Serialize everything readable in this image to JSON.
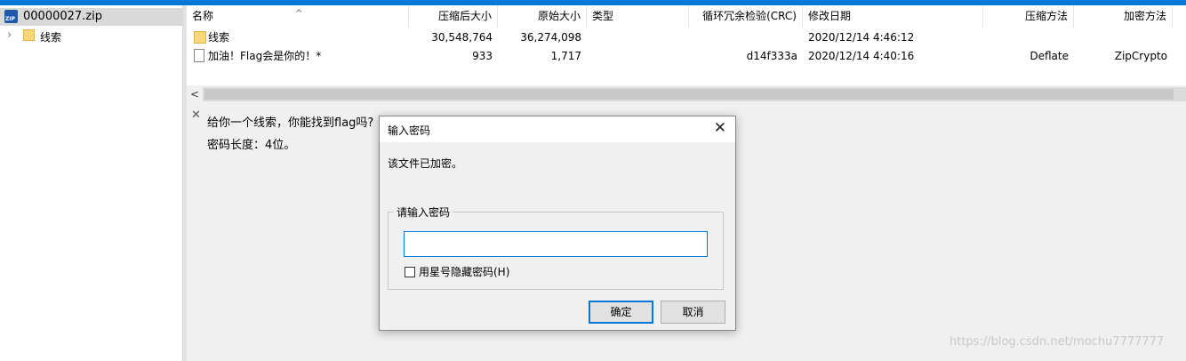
{
  "tree": {
    "root_label": "00000027.zip",
    "root_icon": "zip-icon",
    "children": [
      {
        "label": "线索",
        "icon": "folder-icon"
      }
    ]
  },
  "list": {
    "columns": [
      "名称",
      "压缩后大小",
      "原始大小",
      "类型",
      "循环冗余检验(CRC)",
      "修改日期",
      "压缩方法",
      "加密方法"
    ],
    "rows": [
      {
        "name": "线索",
        "icon": "folder-icon",
        "packed": "30,548,764",
        "size": "36,274,098",
        "type": "",
        "crc": "",
        "modified": "2020/12/14 4:46:12",
        "method": "",
        "encryption": ""
      },
      {
        "name": "加油！Flag会是你的！*",
        "icon": "file-icon",
        "packed": "933",
        "size": "1,717",
        "type": "",
        "crc": "d14f333a",
        "modified": "2020/12/14 4:40:16",
        "method": "Deflate",
        "encryption": "ZipCrypto"
      }
    ]
  },
  "comment": {
    "line1": "给你一个线索，你能找到flag吗?",
    "line2": "密码长度：4位。"
  },
  "dialog": {
    "title": "输入密码",
    "message": "该文件已加密。",
    "group_label": "请输入密码",
    "password_value": "",
    "mask_checkbox_label": "用星号隐藏密码(H)",
    "mask_checked": false,
    "ok_label": "确定",
    "cancel_label": "取消"
  },
  "watermark": "https://blog.csdn.net/mochu7777777",
  "colors": {
    "accent": "#0078d7",
    "folder": "#f8d775"
  }
}
